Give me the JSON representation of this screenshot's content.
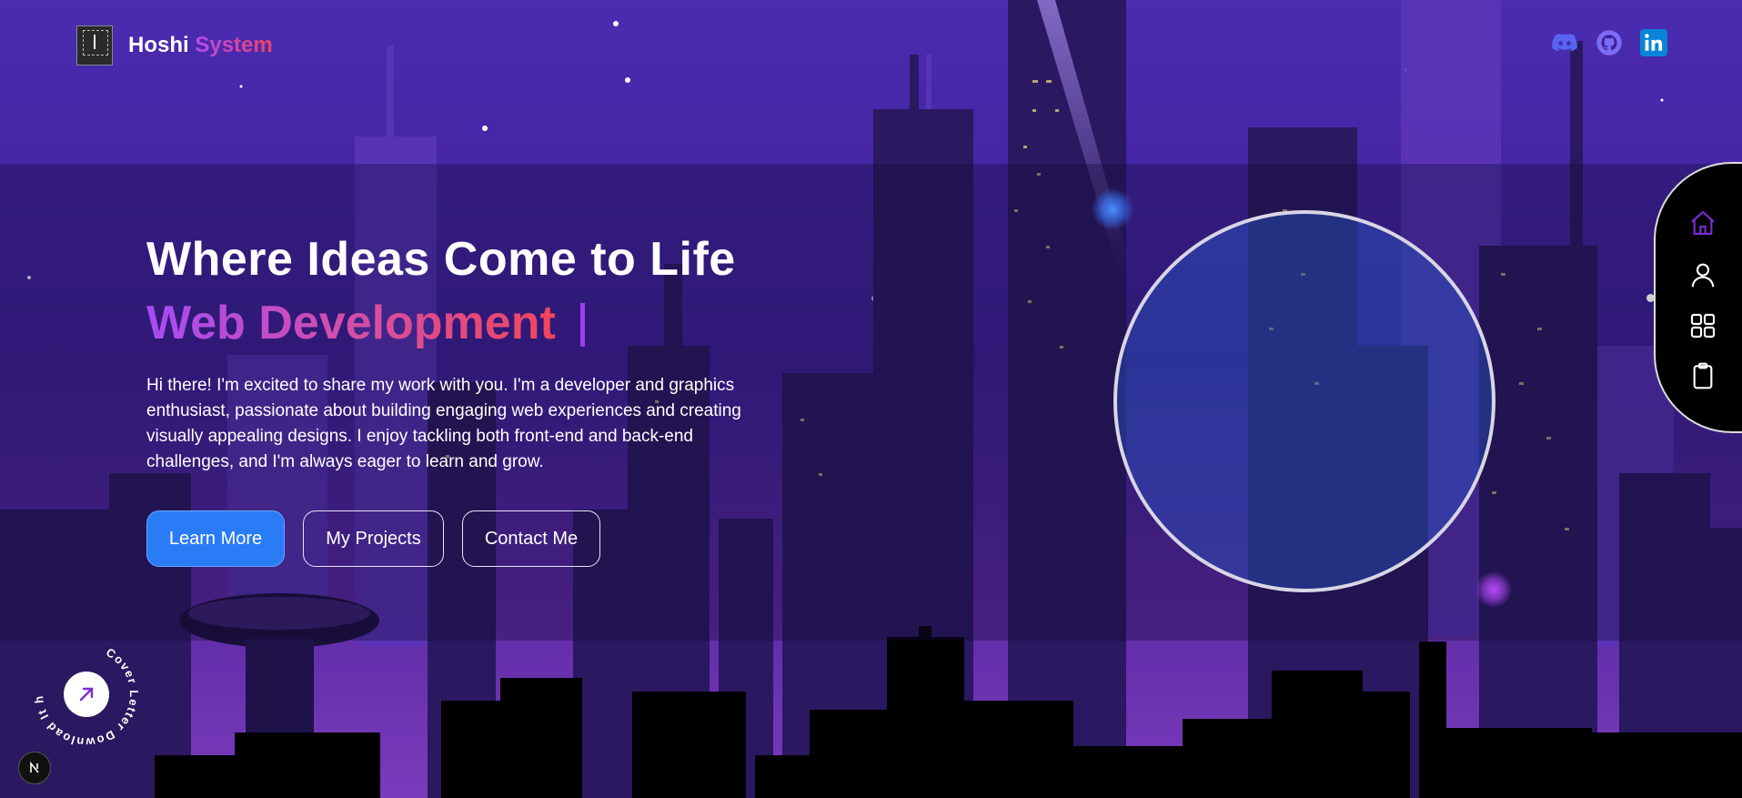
{
  "header": {
    "brand_main": "Hoshi",
    "brand_accent": "System",
    "logo_icon": "chip-logo-icon",
    "social": [
      {
        "name": "discord-icon",
        "color": "#5865f2"
      },
      {
        "name": "github-icon",
        "color": "#7b6cf5"
      },
      {
        "name": "linkedin-icon",
        "color": "#0a84d6"
      }
    ]
  },
  "hero": {
    "title": "Where Ideas Come to Life",
    "typed_text": "Web Development",
    "description": "Hi there! I'm excited to share my work with you. I'm a developer and graphics enthusiast, passionate about building engaging web experiences and creating visually appealing designs. I enjoy tackling both front-end and back-end challenges, and I'm always eager to learn and grow.",
    "buttons": {
      "learn_more": "Learn More",
      "projects": "My Projects",
      "contact": "Contact Me"
    }
  },
  "side_nav": {
    "items": [
      "home-icon",
      "user-icon",
      "grid-icon",
      "clipboard-icon"
    ],
    "active_color": "#7b2bd6"
  },
  "badge": {
    "circular_text": "Cover Letter Download It here"
  },
  "colors": {
    "accent_blue": "#2a7cf6",
    "gradient_start": "#a64bf4",
    "gradient_end": "#f2465a"
  }
}
